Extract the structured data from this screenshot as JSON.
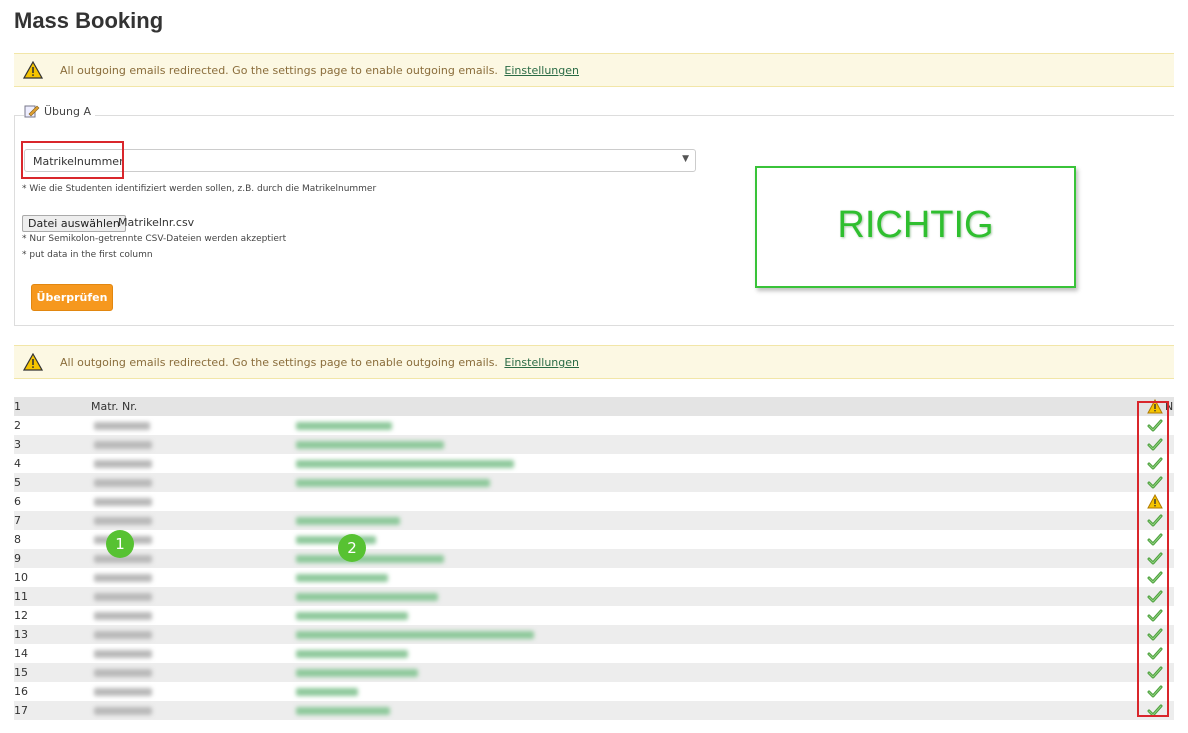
{
  "page": {
    "title": "Mass Booking"
  },
  "alerts": [
    {
      "message": "All outgoing emails redirected. Go the settings page to enable outgoing emails.",
      "link": "Einstellungen"
    },
    {
      "message": "All outgoing emails redirected. Go the settings page to enable outgoing emails.",
      "link": "Einstellungen"
    }
  ],
  "form": {
    "section_label": "Übung A",
    "identifier_select": {
      "selected": "Matrikelnummer"
    },
    "identifier_hint": "* Wie die Studenten identifiziert werden sollen, z.B. durch die Matrikelnummer",
    "file_button": "Datei auswählen",
    "file_name": "Matrikelnr.csv",
    "file_hint_1": "* Nur Semikolon-getrennte CSV-Dateien werden akzeptiert",
    "file_hint_2": "* put data in the first column",
    "submit_button": "Überprüfen"
  },
  "annotation": {
    "text": "RICHTIG",
    "color": "#2fbf2f"
  },
  "badges": [
    "1",
    "2"
  ],
  "table": {
    "header": {
      "num": "1",
      "col1": "Matr. Nr.",
      "last": "N"
    },
    "rows": [
      {
        "num": "2",
        "status": "ok"
      },
      {
        "num": "3",
        "status": "ok"
      },
      {
        "num": "4",
        "status": "ok"
      },
      {
        "num": "5",
        "status": "ok"
      },
      {
        "num": "6",
        "status": "warning"
      },
      {
        "num": "7",
        "status": "ok"
      },
      {
        "num": "8",
        "status": "ok"
      },
      {
        "num": "9",
        "status": "ok"
      },
      {
        "num": "10",
        "status": "ok"
      },
      {
        "num": "11",
        "status": "ok"
      },
      {
        "num": "12",
        "status": "ok"
      },
      {
        "num": "13",
        "status": "ok"
      },
      {
        "num": "14",
        "status": "ok"
      },
      {
        "num": "15",
        "status": "ok"
      },
      {
        "num": "16",
        "status": "ok"
      },
      {
        "num": "17",
        "status": "ok"
      }
    ]
  },
  "colors": {
    "warning_bg": "#fcf8e3",
    "ok_green": "#4a9e3a",
    "warning_yellow": "#f0b400",
    "orange_button": "#f6981e",
    "highlight_red": "#d9262b"
  }
}
